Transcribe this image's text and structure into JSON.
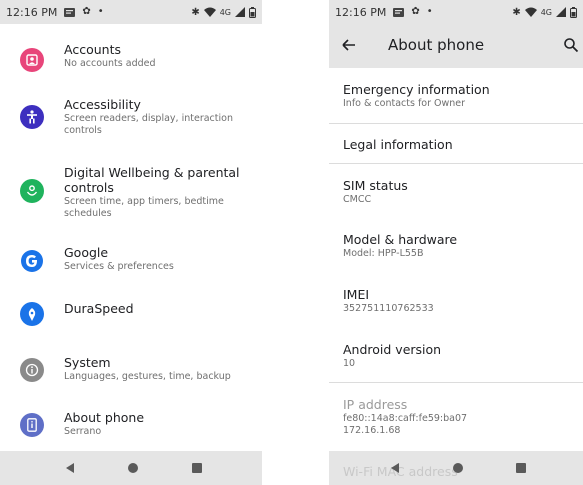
{
  "colors": {
    "bar_bg": "#e5e5e5",
    "accounts": "#e8457a",
    "accessibility": "#3d2fbf",
    "wellbeing": "#1fb35d",
    "google": "#1a73e8",
    "duraspeed": "#1a73e8",
    "system": "#8a8a8a",
    "about": "#5f6fc7"
  },
  "left_screen": {
    "status_bar": {
      "time": "12:16 PM",
      "network": "4G"
    },
    "items": [
      {
        "icon": "accounts-icon",
        "title": "Accounts",
        "subtitle": "No accounts added"
      },
      {
        "icon": "accessibility-icon",
        "title": "Accessibility",
        "subtitle": "Screen readers, display, interaction controls"
      },
      {
        "icon": "wellbeing-icon",
        "title": "Digital Wellbeing & parental controls",
        "subtitle": "Screen time, app timers, bedtime schedules"
      },
      {
        "icon": "google-icon",
        "title": "Google",
        "subtitle": "Services & preferences"
      },
      {
        "icon": "duraspeed-icon",
        "title": "DuraSpeed",
        "subtitle": ""
      },
      {
        "icon": "system-icon",
        "title": "System",
        "subtitle": "Languages, gestures, time, backup"
      },
      {
        "icon": "about-phone-icon",
        "title": "About phone",
        "subtitle": "Serrano"
      }
    ]
  },
  "right_screen": {
    "status_bar": {
      "time": "12:16 PM",
      "network": "4G"
    },
    "app_bar": {
      "title": "About phone"
    },
    "rows": [
      {
        "title": "Emergency information",
        "subtitle": "Info & contacts for Owner"
      },
      {
        "title": "Legal information",
        "subtitle": ""
      },
      {
        "title": "SIM status",
        "subtitle": "CMCC"
      },
      {
        "title": "Model & hardware",
        "subtitle": "Model: HPP-L55B"
      },
      {
        "title": "IMEI",
        "subtitle": "352751110762533"
      },
      {
        "title": "Android version",
        "subtitle": "10"
      },
      {
        "title": "IP address",
        "subtitle": "fe80::14a8:caff:fe59:ba07",
        "subtitle2": "172.16.1.68"
      }
    ],
    "faded_row": "Wi-Fi MAC address"
  }
}
